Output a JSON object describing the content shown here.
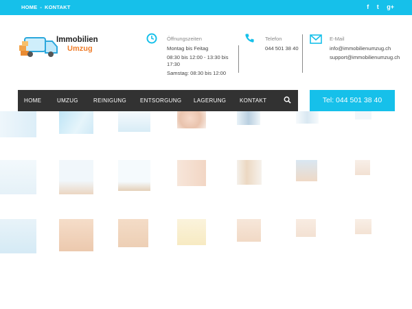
{
  "topbar": {
    "links": [
      "HOME",
      "KONTAKT"
    ],
    "separator": "-",
    "social": [
      {
        "name": "facebook-icon",
        "glyph": "f"
      },
      {
        "name": "twitter-icon",
        "glyph": "t"
      },
      {
        "name": "google-plus-icon",
        "glyph": "g+"
      }
    ]
  },
  "logo": {
    "line1": "Immobilien",
    "line2": "Umzug"
  },
  "opening": {
    "label": "Öffnungszeiten",
    "line1": "Montag bis Feitag",
    "line2": "08:30 bis 12:00 - 13:30 bis",
    "line3": "17:30",
    "line4": "Samstag: 08:30 bis 12:00"
  },
  "phone": {
    "label": "Telefon",
    "value": "044 501 38 40"
  },
  "email": {
    "label": "E-Mail",
    "value1": "info@immobilienumzug.ch",
    "value2": "support@immobilienumzug.ch"
  },
  "nav": {
    "items": [
      "HOME",
      "UMZUG",
      "REINIGUNG",
      "ENTSORGUNG",
      "LAGERUNG",
      "KONTAKT"
    ]
  },
  "cta": {
    "label": "Tel: 044 501 38 40"
  },
  "colors": {
    "accent": "#16c0ea",
    "nav_bg": "#323232",
    "logo_orange": "#f07d2a"
  }
}
